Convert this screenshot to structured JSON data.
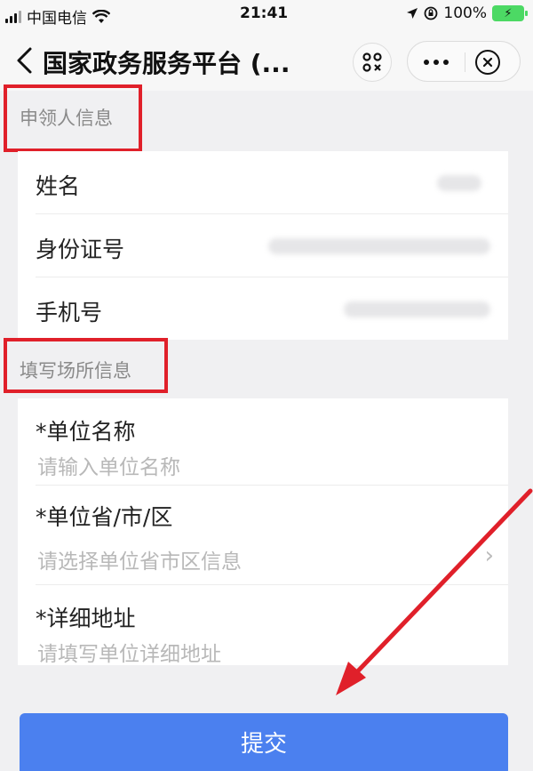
{
  "status_bar": {
    "carrier": "中国电信",
    "time": "21:41",
    "battery": "100%"
  },
  "nav": {
    "title": "国家政务服务平台 (...",
    "back_icon": "chevron-left-icon",
    "scan_icon": "scan-icon",
    "more_icon": "more-dots-icon",
    "close_icon": "close-circle-icon"
  },
  "applicant_section": {
    "header": "申领人信息",
    "rows": [
      {
        "label": "姓名"
      },
      {
        "label": "身份证号"
      },
      {
        "label": "手机号"
      }
    ]
  },
  "venue_section": {
    "header": "填写场所信息",
    "fields": [
      {
        "label": "*单位名称",
        "placeholder": "请输入单位名称"
      },
      {
        "label": "*单位省/市/区",
        "placeholder": "请选择单位省市区信息"
      },
      {
        "label": "*详细地址",
        "placeholder": "请填写单位详细地址"
      }
    ]
  },
  "submit": {
    "label": "提交"
  },
  "colors": {
    "accent": "#4b80ef",
    "annotation_red": "#e0202a",
    "background": "#f0f0f2"
  }
}
